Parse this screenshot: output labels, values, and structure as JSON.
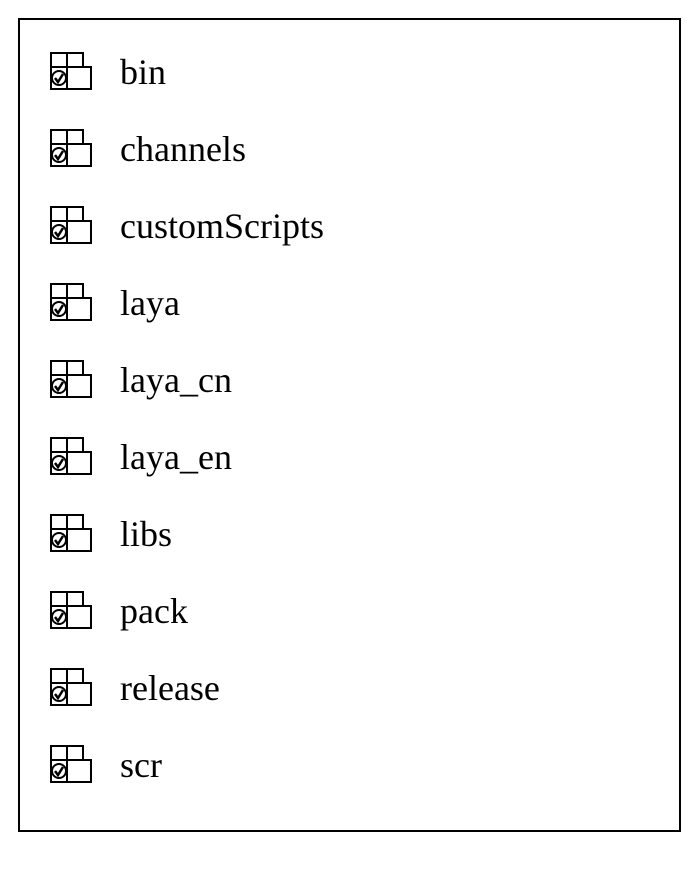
{
  "folders": {
    "items": [
      {
        "label": "bin"
      },
      {
        "label": "channels"
      },
      {
        "label": "customScripts"
      },
      {
        "label": "laya"
      },
      {
        "label": "laya_cn"
      },
      {
        "label": "laya_en"
      },
      {
        "label": "libs"
      },
      {
        "label": "pack"
      },
      {
        "label": "release"
      },
      {
        "label": "scr"
      }
    ]
  }
}
